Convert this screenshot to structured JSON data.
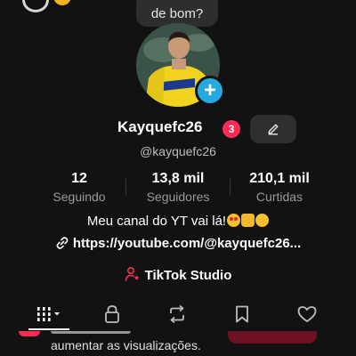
{
  "top_bubble": {
    "text": "de bom?"
  },
  "profile": {
    "username": "Kayquefc26",
    "notification_count": "3",
    "handle": "@kayquefc26"
  },
  "stats": [
    {
      "value": "12",
      "label": "Seguindo"
    },
    {
      "value": "13,8 mil",
      "label": "Seguidores"
    },
    {
      "value": "210,1 mil",
      "label": "Curtidas"
    }
  ],
  "bio": {
    "text": "Meu canal do YT vai lá!",
    "emojis": [
      "heart-eyes-emoji",
      "thumbs-up-emoji",
      "wink-emoji"
    ]
  },
  "link": {
    "icon": "link-icon",
    "text": "https://youtube.com/@kayquefc26..."
  },
  "studio": {
    "icon": "studio-person-icon",
    "label": "TikTok Studio",
    "icon_color": "#fe2c55"
  },
  "tabs": [
    {
      "icon": "grid-videos-icon",
      "active": true
    },
    {
      "icon": "lock-icon",
      "active": false
    },
    {
      "icon": "repost-icon",
      "active": false
    },
    {
      "icon": "bookmark-icon",
      "active": false
    },
    {
      "icon": "heart-icon",
      "active": false
    }
  ],
  "bottom_banner": {
    "text": "aumentar as visualizações."
  },
  "colors": {
    "background": "#121212",
    "accent": "#fe2c55",
    "add_button": "#26a9e0",
    "secondary_text": "#9a9a9a"
  }
}
